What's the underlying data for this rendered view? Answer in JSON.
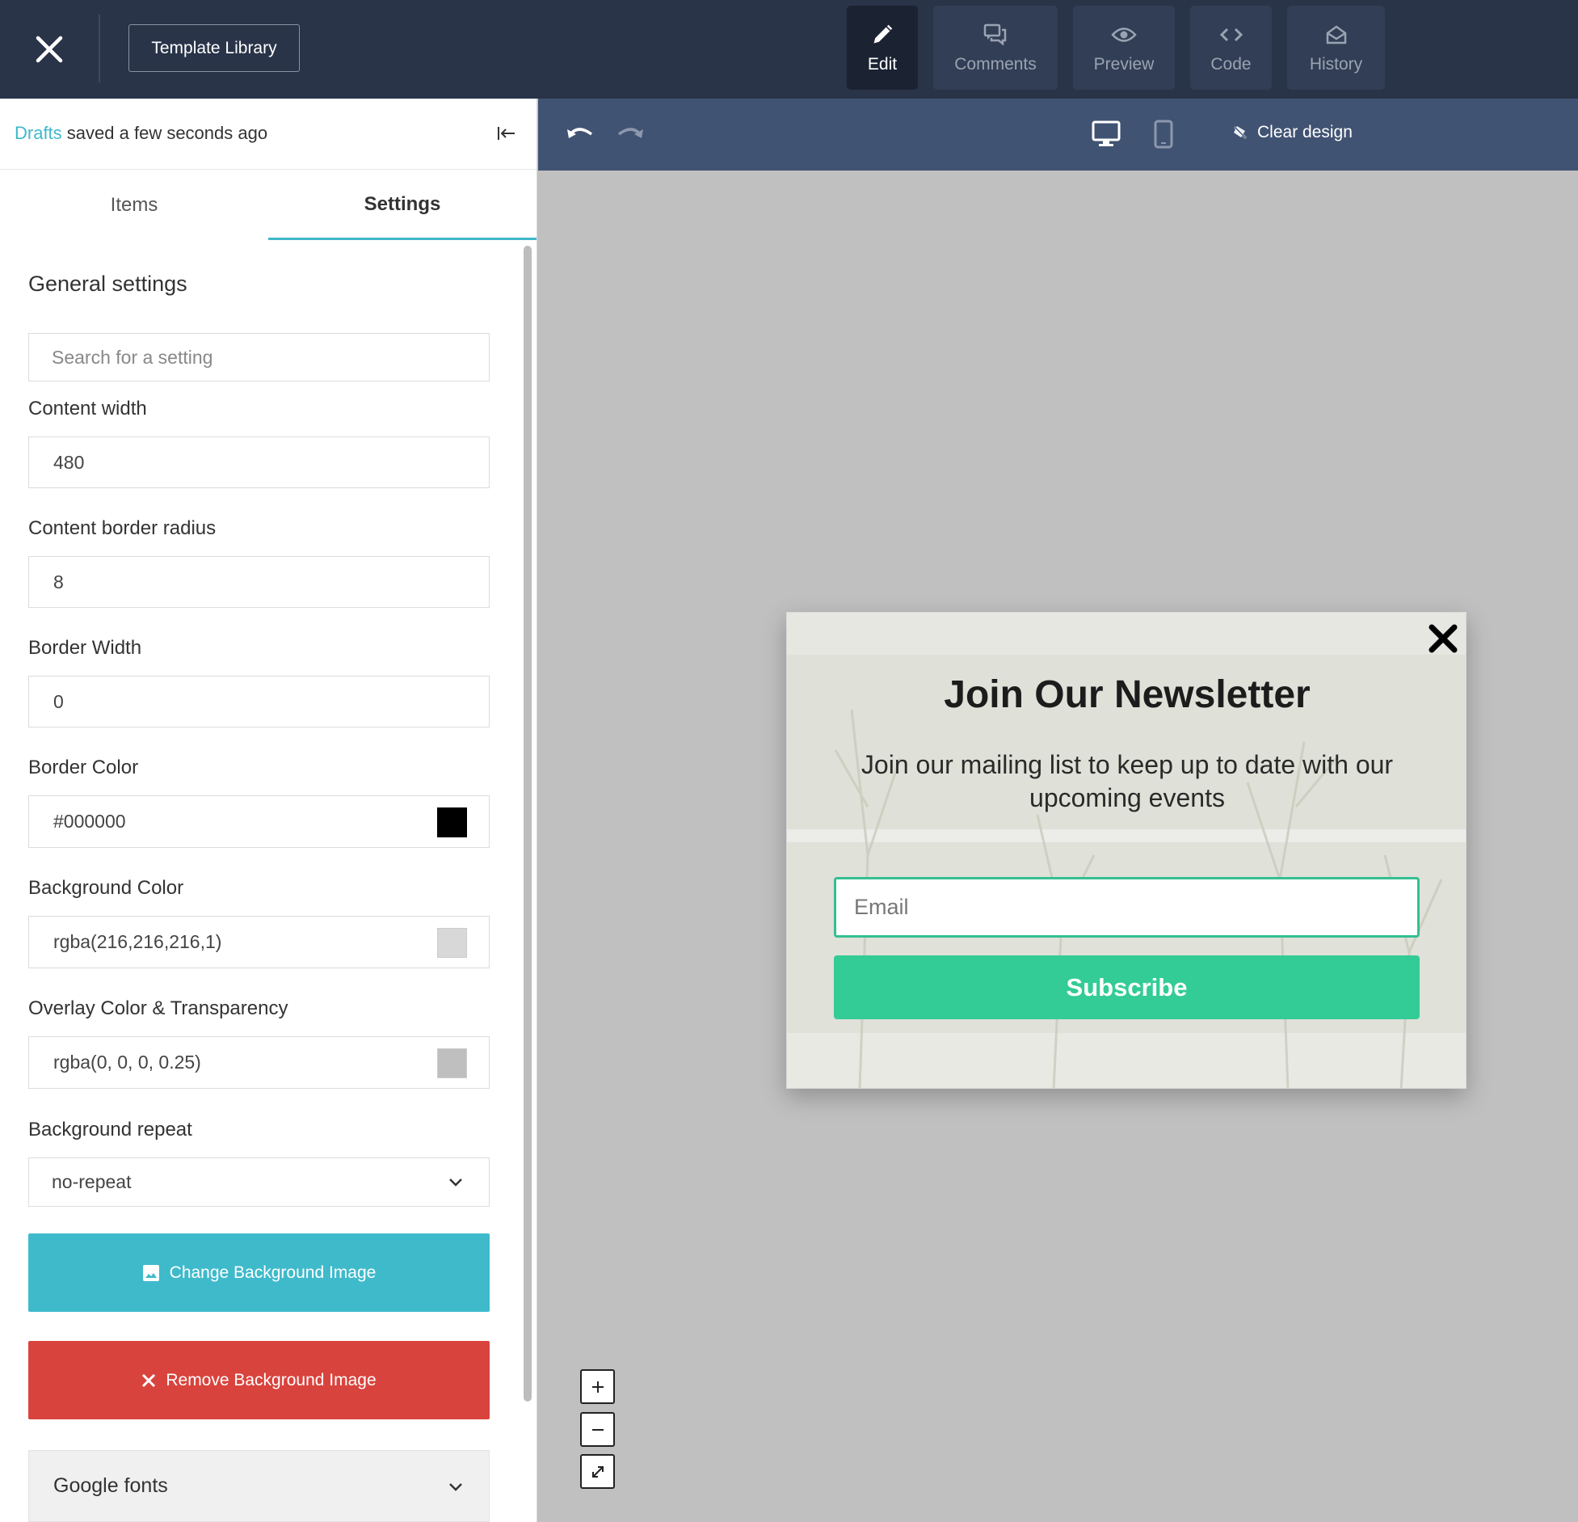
{
  "topbar": {
    "template_library_label": "Template Library",
    "modes": [
      {
        "label": "Edit",
        "icon": "pencil-icon",
        "active": true
      },
      {
        "label": "Comments",
        "icon": "comments-icon",
        "active": false
      },
      {
        "label": "Preview",
        "icon": "eye-icon",
        "active": false
      },
      {
        "label": "Code",
        "icon": "code-icon",
        "active": false
      },
      {
        "label": "History",
        "icon": "history-icon",
        "active": false
      }
    ]
  },
  "sidebar": {
    "draft_link": "Drafts",
    "draft_status": " saved a few seconds ago",
    "tabs": [
      {
        "label": "Items",
        "active": false
      },
      {
        "label": "Settings",
        "active": true
      }
    ],
    "section_title": "General settings",
    "search_placeholder": "Search for a setting",
    "fields": {
      "content_width": {
        "label": "Content width",
        "value": "480"
      },
      "content_border_radius": {
        "label": "Content border radius",
        "value": "8"
      },
      "border_width": {
        "label": "Border Width",
        "value": "0"
      },
      "border_color": {
        "label": "Border Color",
        "value": "#000000",
        "swatch": "#000000"
      },
      "background_color": {
        "label": "Background Color",
        "value": "rgba(216,216,216,1)",
        "swatch": "#d8d8d8"
      },
      "overlay_color": {
        "label": "Overlay Color & Transparency",
        "value": "rgba(0, 0, 0, 0.25)",
        "swatch": "#bfbfbf"
      },
      "background_repeat": {
        "label": "Background repeat",
        "value": "no-repeat"
      }
    },
    "change_bg_label": "Change Background Image",
    "remove_bg_label": "Remove Background Image",
    "google_fonts_label": "Google fonts"
  },
  "canvas_toolbar": {
    "clear_design_label": "Clear design"
  },
  "popup": {
    "title": "Join Our Newsletter",
    "subtitle": "Join our mailing list to keep up to date with our upcoming events",
    "email_placeholder": "Email",
    "subscribe_label": "Subscribe"
  },
  "colors": {
    "topbar": "#293449",
    "accent": "#3fb8c9",
    "danger": "#d9433d",
    "subscribe": "#33cc96",
    "canvas": "#c0c0c0"
  }
}
